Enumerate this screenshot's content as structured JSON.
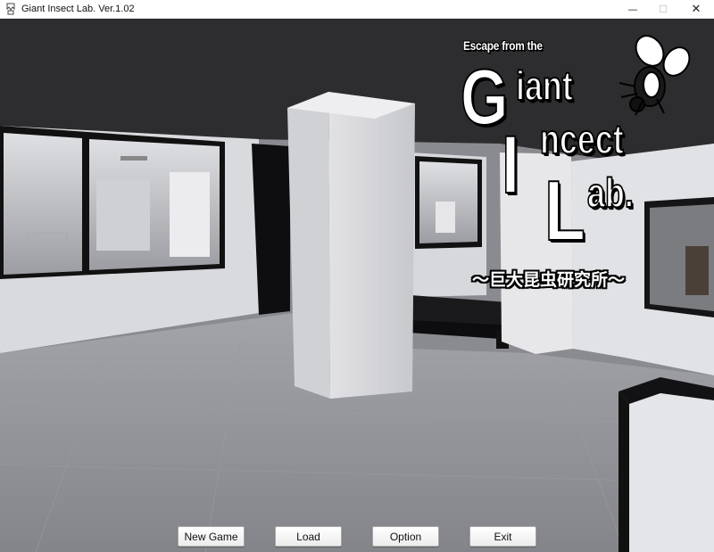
{
  "window": {
    "title": "Giant Insect Lab. Ver.1.02",
    "min_glyph": "—",
    "max_glyph": "☐",
    "close_glyph": "✕"
  },
  "logo": {
    "line1": "Escape from the",
    "giant_first": "G",
    "giant_rest": "iant",
    "incect_first": "I",
    "incect_rest": "ncect",
    "lab_first": "L",
    "lab_rest": "ab.",
    "subtitle": "～巨大昆虫研究所～",
    "icon": "fly-icon"
  },
  "menu": {
    "new_game": "New Game",
    "load": "Load",
    "option": "Option",
    "exit": "Exit"
  },
  "colors": {
    "ceiling": "#2b2b2d",
    "floor": "#8e8f94",
    "wall": "#e3e3e7",
    "logo_fill": "#ffffff",
    "logo_outline": "#000000"
  }
}
